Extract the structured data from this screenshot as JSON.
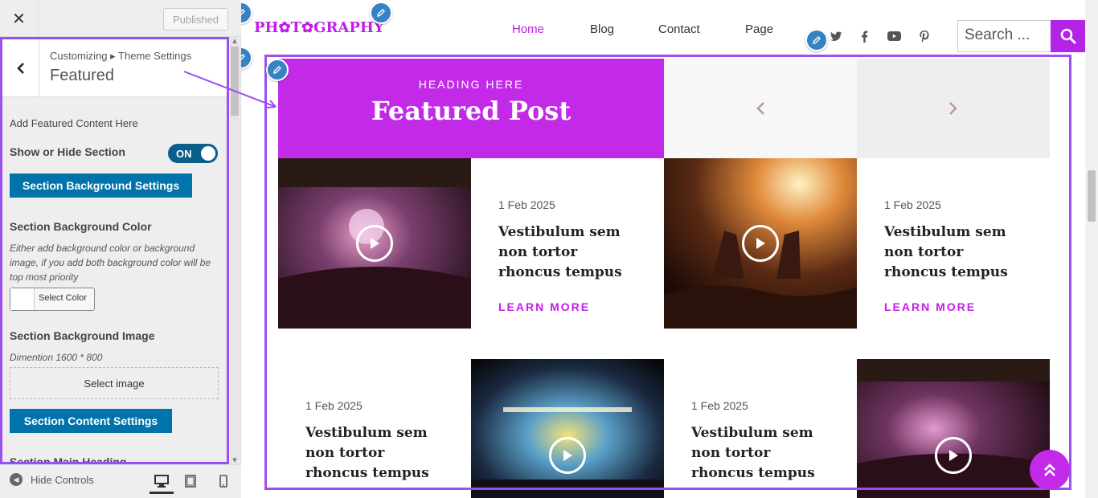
{
  "panel": {
    "close_label": "✕",
    "published_label": "Published",
    "breadcrumb": "Customizing ▸ Theme Settings",
    "section_title": "Featured",
    "intro": "Add Featured Content Here",
    "show_hide_label": "Show or Hide Section",
    "toggle_label": "ON",
    "bg_settings_button": "Section Background Settings",
    "bg_color_label": "Section Background Color",
    "bg_color_desc": "Either add background color or background image, if you add both background color will be top most priority",
    "select_color_label": "Select Color",
    "bg_image_label": "Section Background Image",
    "bg_image_desc": "Dimention 1600 * 800",
    "select_image_label": "Select image",
    "content_settings_button": "Section Content Settings",
    "main_heading_label": "Section Main Heading",
    "hide_controls_label": "Hide Controls"
  },
  "site": {
    "logo": "PH✿T✿GRAPHY",
    "nav": [
      "Home",
      "Blog",
      "Contact",
      "Page"
    ],
    "search_placeholder": "Search ...",
    "heading_small": "HEADING HERE",
    "heading_big": "Featured Post",
    "cards": [
      {
        "date": "1 Feb 2025",
        "title": "Vestibulum sem non tortor rhoncus tempus",
        "cta": "LEARN MORE"
      },
      {
        "date": "1 Feb 2025",
        "title": "Vestibulum sem non tortor rhoncus tempus",
        "cta": "LEARN MORE"
      },
      {
        "date": "1 Feb 2025",
        "title": "Vestibulum sem non tortor rhoncus tempus"
      },
      {
        "date": "1 Feb 2025",
        "title": "Vestibulum sem non tortor rhoncus tempus"
      }
    ]
  },
  "colors": {
    "accent": "#c32ae8",
    "highlight_border": "#9c4df4",
    "wp_blue": "#0073aa",
    "edit_pencil": "#3582c4"
  },
  "icons": {
    "social": [
      "twitter-icon",
      "facebook-icon",
      "youtube-icon",
      "pinterest-icon"
    ]
  }
}
